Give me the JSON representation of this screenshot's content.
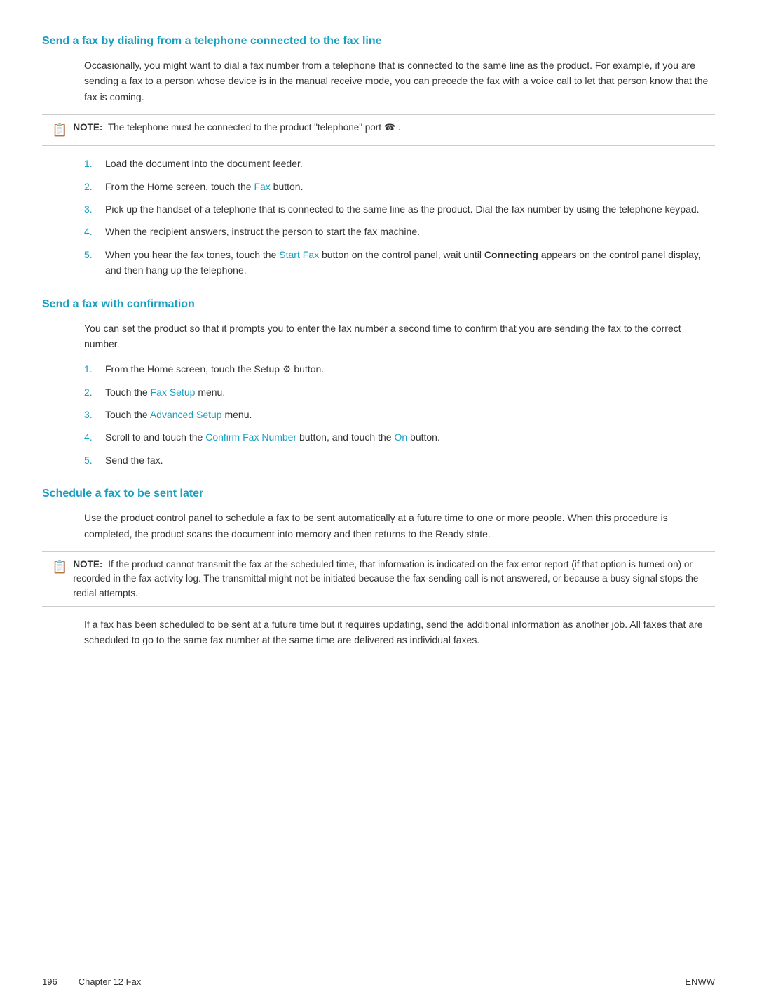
{
  "sections": [
    {
      "id": "section-dial-telephone",
      "heading": "Send a fax by dialing from a telephone connected to the fax line",
      "intro": "Occasionally, you might want to dial a fax number from a telephone that is connected to the same line as the product. For example, if you are sending a fax to a person whose device is in the manual receive mode, you can precede the fax with a voice call to let that person know that the fax is coming.",
      "note": {
        "label": "NOTE:",
        "text": "The telephone must be connected to the product \"telephone\" port"
      },
      "steps": [
        {
          "num": "1.",
          "text": "Load the document into the document feeder.",
          "links": []
        },
        {
          "num": "2.",
          "text_before": "From the Home screen, touch the ",
          "link": "Fax",
          "text_after": " button.",
          "links": [
            "Fax"
          ]
        },
        {
          "num": "3.",
          "text": "Pick up the handset of a telephone that is connected to the same line as the product. Dial the fax number by using the telephone keypad.",
          "links": []
        },
        {
          "num": "4.",
          "text": "When the recipient answers, instruct the person to start the fax machine.",
          "links": []
        },
        {
          "num": "5.",
          "text_before": "When you hear the fax tones, touch the ",
          "link": "Start Fax",
          "text_after": " button on the control panel, wait until ",
          "bold": "Connecting",
          "text_end": " appears on the control panel display, and then hang up the telephone.",
          "links": [
            "Start Fax"
          ]
        }
      ]
    },
    {
      "id": "section-confirmation",
      "heading": "Send a fax with confirmation",
      "intro": "You can set the product so that it prompts you to enter the fax number a second time to confirm that you are sending the fax to the correct number.",
      "steps": [
        {
          "num": "1.",
          "text_before": "From the Home screen, touch the Setup ",
          "text_after": " button.",
          "has_setup_icon": true
        },
        {
          "num": "2.",
          "text_before": "Touch the ",
          "link": "Fax Setup",
          "text_after": " menu."
        },
        {
          "num": "3.",
          "text_before": "Touch the ",
          "link": "Advanced Setup",
          "text_after": " menu."
        },
        {
          "num": "4.",
          "text_before": "Scroll to and touch the ",
          "link": "Confirm Fax Number",
          "text_after": " button, and touch the ",
          "link2": "On",
          "text_end": " button."
        },
        {
          "num": "5.",
          "text": "Send the fax."
        }
      ]
    },
    {
      "id": "section-schedule",
      "heading": "Schedule a fax to be sent later",
      "intro": "Use the product control panel to schedule a fax to be sent automatically at a future time to one or more people. When this procedure is completed, the product scans the document into memory and then returns to the Ready state.",
      "note": {
        "label": "NOTE:",
        "text": "If the product cannot transmit the fax at the scheduled time, that information is indicated on the fax error report (if that option is turned on) or recorded in the fax activity log. The transmittal might not be initiated because the fax-sending call is not answered, or because a busy signal stops the redial attempts."
      },
      "closing": "If a fax has been scheduled to be sent at a future time but it requires updating, send the additional information as another job. All faxes that are scheduled to go to the same fax number at the same time are delivered as individual faxes."
    }
  ],
  "footer": {
    "page_num": "196",
    "chapter": "Chapter 12   Fax",
    "right_text": "ENWW"
  },
  "colors": {
    "heading": "#1a9fc0",
    "link": "#1a9fc0",
    "note_border": "#cccccc"
  }
}
